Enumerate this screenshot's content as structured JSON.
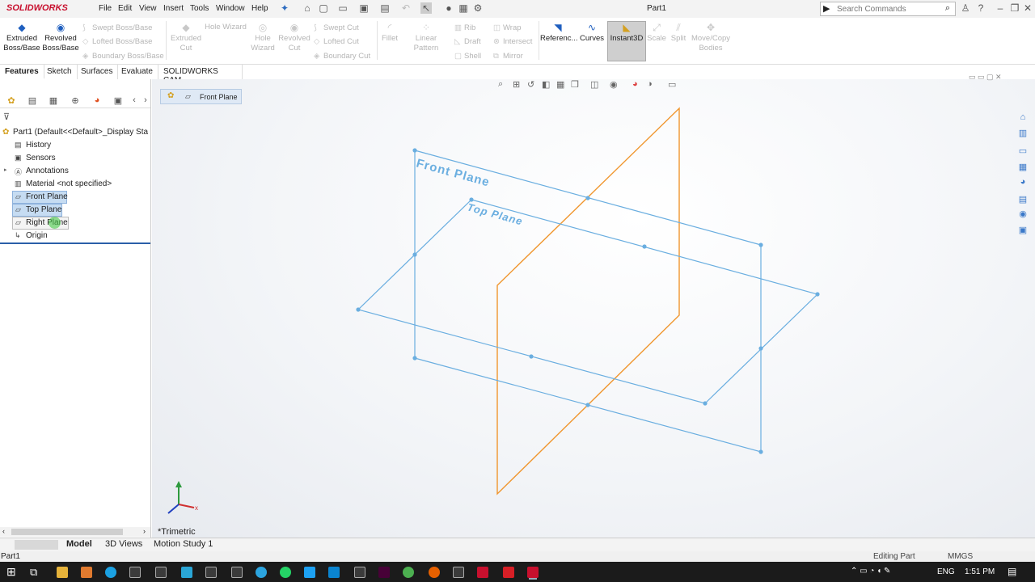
{
  "app": {
    "logo": "SOLIDWORKS",
    "doc_title": "Part1"
  },
  "menu": [
    "File",
    "Edit",
    "View",
    "Insert",
    "Tools",
    "Window",
    "Help"
  ],
  "search": {
    "placeholder": "Search Commands"
  },
  "commands": {
    "extruded_boss": "Extruded Boss/Base",
    "revolved_boss": "Revolved Boss/Base",
    "swept_boss": "Swept Boss/Base",
    "lofted_boss": "Lofted Boss/Base",
    "boundary_boss": "Boundary Boss/Base",
    "extruded_cut": "Extruded Cut",
    "hole_wizard_top": "Hole Wizard",
    "hole_wizard": "Hole Wizard",
    "revolved_cut": "Revolved Cut",
    "swept_cut": "Swept Cut",
    "lofted_cut": "Lofted Cut",
    "boundary_cut": "Boundary Cut",
    "fillet": "Fillet",
    "linear_pattern": "Linear Pattern",
    "rib": "Rib",
    "draft": "Draft",
    "shell": "Shell",
    "wrap": "Wrap",
    "intersect": "Intersect",
    "mirror": "Mirror",
    "reference": "Referenc...",
    "curves": "Curves",
    "instant3d": "Instant3D",
    "scale": "Scale",
    "split": "Split",
    "move_copy": "Move/Copy Bodies"
  },
  "tabs": [
    "Features",
    "Sketch",
    "Surfaces",
    "Evaluate",
    "SOLIDWORKS CAM"
  ],
  "tree": {
    "root": "Part1  (Default<<Default>_Display Sta",
    "items": [
      "History",
      "Sensors",
      "Annotations",
      "Material <not specified>",
      "Front Plane",
      "Top Plane",
      "Right Plane",
      "Origin"
    ]
  },
  "viewport": {
    "breadcrumb": "Front Plane",
    "front_plane_label": "Front Plane",
    "top_plane_label": "Top Plane",
    "view_name": "*Trimetric"
  },
  "bottom_tabs": [
    "Model",
    "3D Views",
    "Motion Study 1"
  ],
  "status": {
    "left": "Part1",
    "mode": "Editing Part",
    "units": "MMGS"
  },
  "taskbar": {
    "lang": "ENG",
    "time": "1:51 PM"
  },
  "colors": {
    "plane_blue": "#6aaee0",
    "plane_orange": "#f0962e",
    "selection": "#c6dcf2"
  }
}
